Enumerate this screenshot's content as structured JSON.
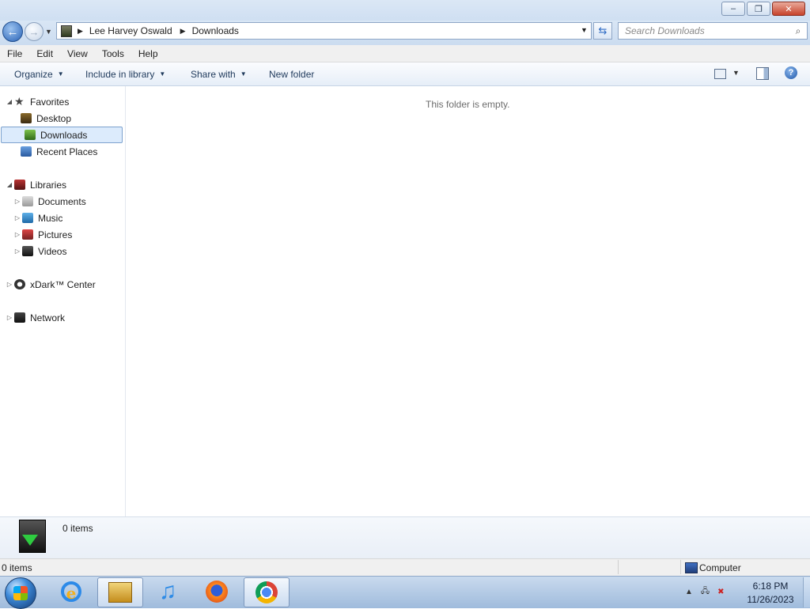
{
  "address": {
    "crumbs": [
      "Lee Harvey Oswald",
      "Downloads"
    ],
    "search_placeholder": "Search Downloads"
  },
  "menu": [
    "File",
    "Edit",
    "View",
    "Tools",
    "Help"
  ],
  "toolbar": {
    "organize": "Organize",
    "include_in_library": "Include in library",
    "share_with": "Share with",
    "new_folder": "New folder"
  },
  "nav": {
    "favorites": {
      "label": "Favorites",
      "items": [
        "Desktop",
        "Downloads",
        "Recent Places"
      ]
    },
    "libraries": {
      "label": "Libraries",
      "items": [
        "Documents",
        "Music",
        "Pictures",
        "Videos"
      ]
    },
    "xdark": "xDark™ Center",
    "network": "Network",
    "selected": "Downloads"
  },
  "content": {
    "empty_message": "This folder is empty."
  },
  "details": {
    "item_count": "0 items"
  },
  "status": {
    "items": "0 items",
    "location": "Computer"
  },
  "taskbar": {
    "pinned": [
      "internet-explorer",
      "windows-explorer",
      "itunes",
      "firefox",
      "chrome"
    ],
    "active": [
      "windows-explorer",
      "chrome"
    ],
    "time": "6:18 PM",
    "date": "11/26/2023"
  },
  "icons": {
    "back": "back-arrow-icon",
    "forward": "forward-arrow-icon",
    "search": "search-icon",
    "help": "help-icon"
  }
}
